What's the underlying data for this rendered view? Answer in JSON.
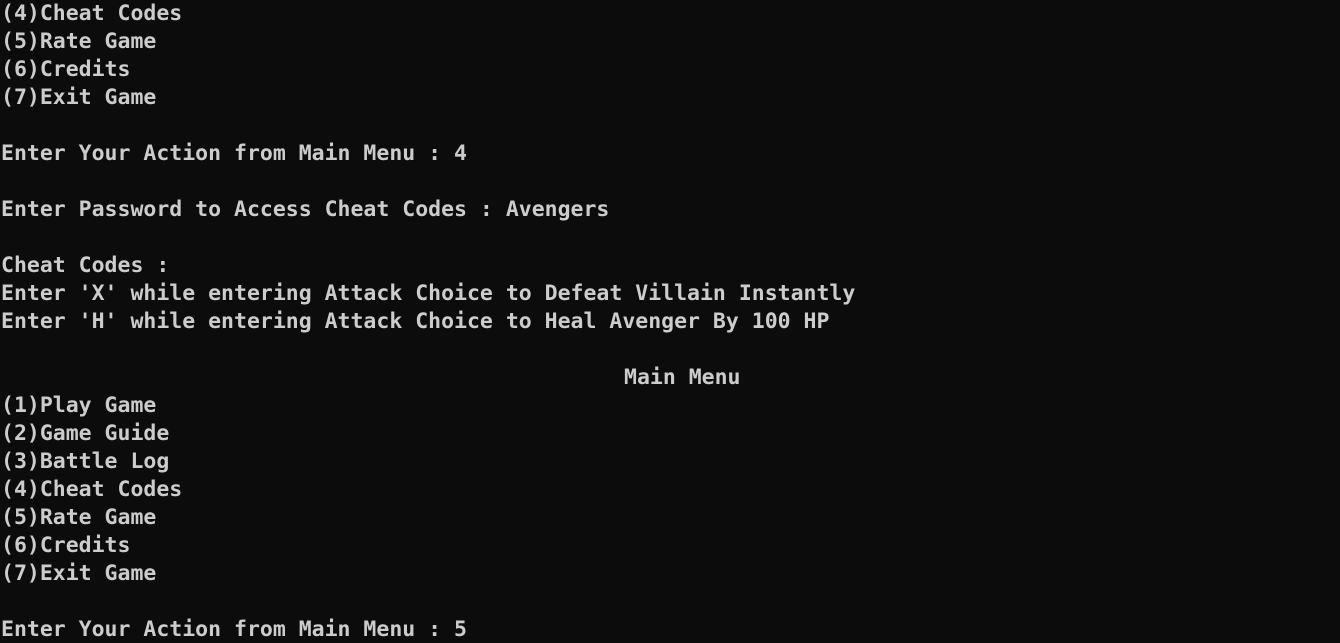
{
  "console": {
    "background": "#0c0c0c",
    "text_color": "#cccccc",
    "lines": [
      "(4)Cheat Codes",
      "(5)Rate Game",
      "(6)Credits",
      "(7)Exit Game",
      "",
      "Enter Your Action from Main Menu : 4",
      "",
      "Enter Password to Access Cheat Codes : Avengers",
      "",
      "Cheat Codes :",
      "Enter 'X' while entering Attack Choice to Defeat Villain Instantly",
      "Enter 'H' while entering Attack Choice to Heal Avenger By 100 HP",
      "",
      "Main Menu",
      "(1)Play Game",
      "(2)Game Guide",
      "(3)Battle Log",
      "(4)Cheat Codes",
      "(5)Rate Game",
      "(6)Credits",
      "(7)Exit Game",
      "",
      "Enter Your Action from Main Menu : 5"
    ]
  }
}
